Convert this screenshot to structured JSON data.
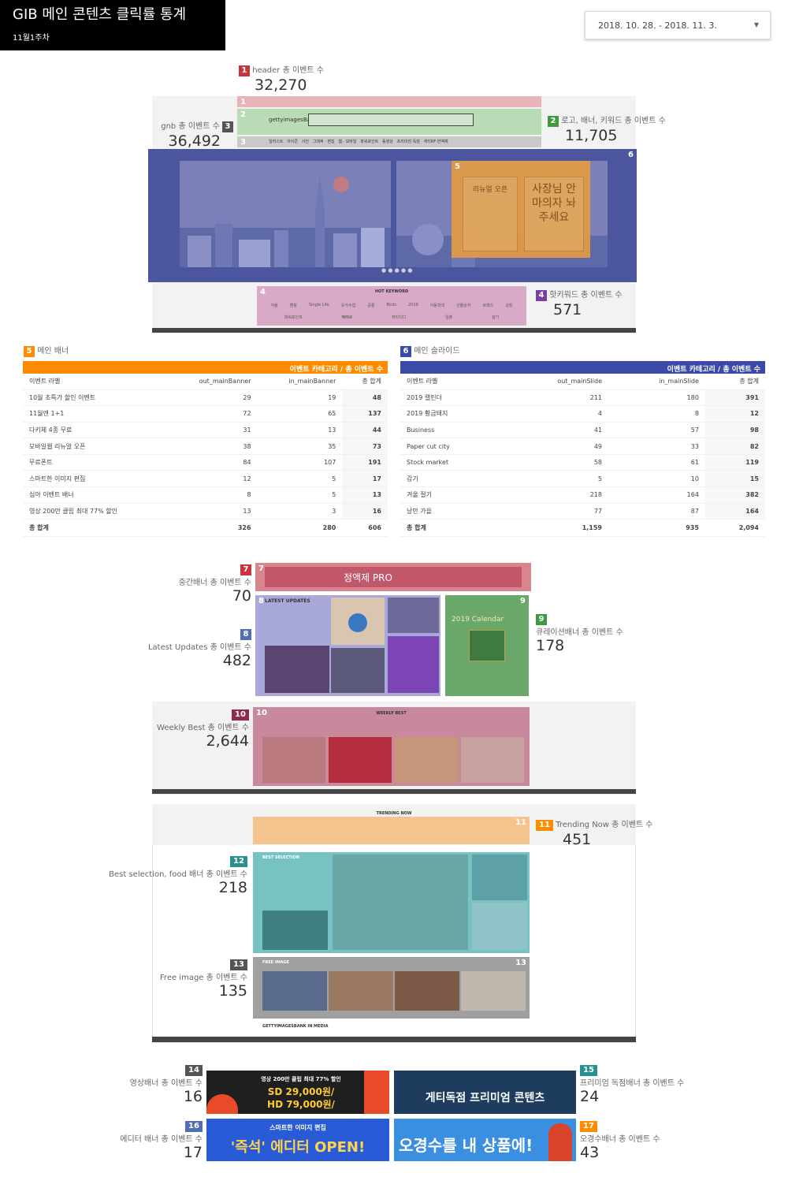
{
  "header": {
    "title": "GIB 메인 콘텐츠 클릭률 통계",
    "subtitle": "11월1주차"
  },
  "date_range": "2018. 10. 28. - 2018. 11. 3.",
  "colors": {
    "red": "#c8333e",
    "green": "#3f9a3f",
    "darkgray": "#555555",
    "blue": "#3b49a8",
    "orange": "#ff8c00",
    "purple": "#7b3fa0",
    "maroon": "#8e2a4c",
    "teal": "#2a8f8f",
    "lightblue": "#5170b3"
  },
  "stats": {
    "s1": {
      "no": "1",
      "label": "header 총 이벤트 수",
      "value": "32,270"
    },
    "s2": {
      "no": "2",
      "label": "로고, 배너, 키워드 총 이벤트 수",
      "value": "11,705"
    },
    "s3": {
      "no": "3",
      "label": "gnb 총 이벤트 수",
      "value": "36,492"
    },
    "s4": {
      "no": "4",
      "label": "핫키워드 총 이벤트 수",
      "value": "571"
    },
    "s7": {
      "no": "7",
      "label": "중간배너 총 이벤트 수",
      "value": "70"
    },
    "s8": {
      "no": "8",
      "label": "Latest Updates 총 이벤트 수",
      "value": "482"
    },
    "s9": {
      "no": "9",
      "label": "큐레이션배너 총 이벤트 수",
      "value": "178"
    },
    "s10": {
      "no": "10",
      "label": "Weekly Best 총 이벤트 수",
      "value": "2,644"
    },
    "s11": {
      "no": "11",
      "label": "Trending Now 총 이벤트 수",
      "value": "451"
    },
    "s12": {
      "no": "12",
      "label": "Best selection, food 배너 총 이벤트 수",
      "value": "218"
    },
    "s13": {
      "no": "13",
      "label": "Free image 총 이벤트 수",
      "value": "135"
    },
    "s14": {
      "no": "14",
      "label": "영상배너 총 이벤트 수",
      "value": "16"
    },
    "s15": {
      "no": "15",
      "label": "프리미엄 독점배너 총 이벤트 수",
      "value": "24"
    },
    "s16": {
      "no": "16",
      "label": "에디터 배너 총 이벤트 수",
      "value": "17"
    },
    "s17": {
      "no": "17",
      "label": "오경수배너 총 이벤트 수",
      "value": "43"
    }
  },
  "mock": {
    "gnb": [
      "일러스트",
      "아이콘",
      "사진",
      "그래픽 · 편집",
      "웹 · 모바일",
      "파워포인트",
      "동영상",
      "프리미엄 독점",
      "게티RF 반액제"
    ],
    "hot_keyword_title": "HOT KEYWORD",
    "hot_keywords": [
      "겨울",
      "캠핑",
      "Single Life",
      "유가수업",
      "공룡",
      "Birds",
      "2019",
      "아동학대",
      "선물상자",
      "로켓스",
      "김장",
      "파워포인트",
      "빼빼로",
      "뷰티디디",
      "일출",
      "설기"
    ],
    "logo": "gettyimagesBank",
    "slide_banner_1": "리뉴얼 오픈",
    "slide_banner_2": "사장님 안마의자 놔주세요",
    "mid_banner": "정액제 PRO",
    "latest_updates": "LATEST UPDATES",
    "calendar": "2019 Calendar",
    "weekly_best": "WEEKLY BEST",
    "trending_now": "TRENDING NOW",
    "best_selection": "BEST SELECTION",
    "free_image": "FREE IMAGE",
    "in_media": "GETTYIMAGESBANK IN MEDIA",
    "banner14_line1": "영상 200만 클립 최대 77% 할인",
    "banner14_line2": "SD 29,000원/",
    "banner14_line3": "HD 79,000원/",
    "banner15": "게티독점 프리미엄 콘텐츠",
    "banner16_small": "스마트한 이미지 편집",
    "banner16": "'즉석' 에디터 OPEN!",
    "banner17": "오경수를 내 상품에!"
  },
  "table5": {
    "no": "5",
    "title": "메인 배너",
    "bar": "이벤트 카테고리 / 총 이벤트 수",
    "columns": [
      "이벤트 라벨",
      "out_mainBanner",
      "in_mainBanner",
      "총 합계"
    ],
    "rows": [
      [
        "10월 초특가 할인 이벤트",
        "29",
        "19",
        "48"
      ],
      [
        "11월엔 1+1",
        "72",
        "65",
        "137"
      ],
      [
        "다키체 4종 무료",
        "31",
        "13",
        "44"
      ],
      [
        "모바일웹 리뉴얼 오픈",
        "38",
        "35",
        "73"
      ],
      [
        "무료폰트",
        "84",
        "107",
        "191"
      ],
      [
        "스마트한 이미지 편집",
        "12",
        "5",
        "17"
      ],
      [
        "심아 이벤트 배너",
        "8",
        "5",
        "13"
      ],
      [
        "영상 200만 클립 최대 77% 할인",
        "13",
        "3",
        "16"
      ]
    ],
    "total": [
      "총 합계",
      "326",
      "280",
      "606"
    ]
  },
  "table6": {
    "no": "6",
    "title": "메인 슬라이드",
    "bar": "이벤트 카테고리 / 총 이벤트 수",
    "columns": [
      "이벤트 라벨",
      "out_mainSlide",
      "in_mainSlide",
      "총 합계"
    ],
    "rows": [
      [
        "2019 캘린더",
        "211",
        "180",
        "391"
      ],
      [
        "2019 황금돼지",
        "4",
        "8",
        "12"
      ],
      [
        "Business",
        "41",
        "57",
        "98"
      ],
      [
        "Paper cut city",
        "49",
        "33",
        "82"
      ],
      [
        "Stock market",
        "58",
        "61",
        "119"
      ],
      [
        "감기",
        "5",
        "10",
        "15"
      ],
      [
        "겨울 절기",
        "218",
        "164",
        "382"
      ],
      [
        "낭만 가을",
        "77",
        "87",
        "164"
      ]
    ],
    "total": [
      "총 합계",
      "1,159",
      "935",
      "2,094"
    ]
  }
}
